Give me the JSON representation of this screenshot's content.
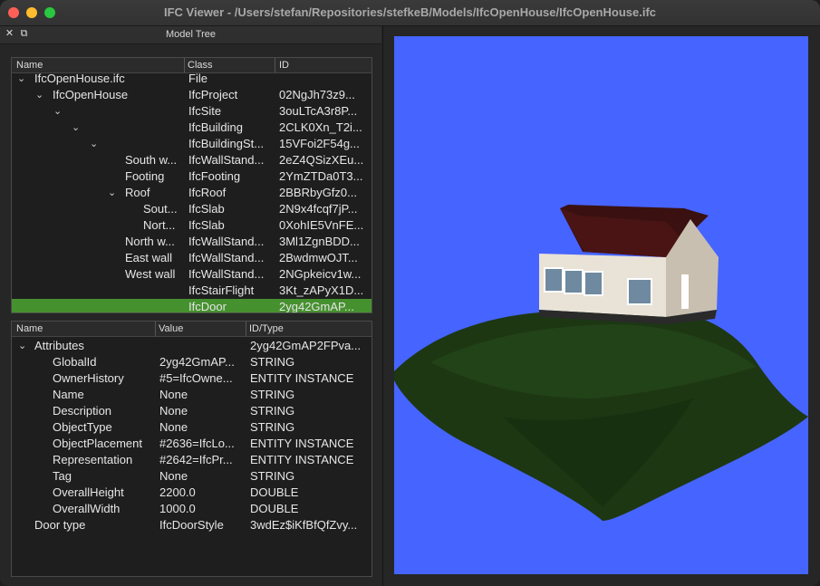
{
  "window": {
    "title": "IFC Viewer - /Users/stefan/Repositories/stefkeB/Models/IfcOpenHouse/IfcOpenHouse.ifc"
  },
  "dock": {
    "title": "Model Tree",
    "close_icon": "✕",
    "float_icon": "⧉"
  },
  "tree": {
    "columns": [
      "Name",
      "Class",
      "ID"
    ],
    "rows": [
      {
        "arrow": "⌄",
        "name": "IfcOpenHouse.ifc",
        "cls": "File",
        "id": ""
      },
      {
        "arrow": "⌄",
        "name": "IfcOpenHouse",
        "cls": "IfcProject",
        "id": "02NgJh73z9..."
      },
      {
        "arrow": "⌄",
        "name": "",
        "cls": "IfcSite",
        "id": "3ouLTcA3r8P..."
      },
      {
        "arrow": "⌄",
        "name": "",
        "cls": "IfcBuilding",
        "id": "2CLK0Xn_T2i..."
      },
      {
        "arrow": "⌄",
        "name": "",
        "cls": "IfcBuildingSt...",
        "id": "15VFoi2F54g..."
      },
      {
        "arrow": "",
        "name": "South w...",
        "cls": "IfcWallStand...",
        "id": "2eZ4QSizXEu..."
      },
      {
        "arrow": "",
        "name": "Footing",
        "cls": "IfcFooting",
        "id": "2YmZTDa0T3..."
      },
      {
        "arrow": "⌄",
        "name": "Roof",
        "cls": "IfcRoof",
        "id": "2BBRbyGfz0..."
      },
      {
        "arrow": "",
        "name": "Sout...",
        "cls": "IfcSlab",
        "id": "2N9x4fcqf7jP..."
      },
      {
        "arrow": "",
        "name": "Nort...",
        "cls": "IfcSlab",
        "id": "0XohIE5VnFE..."
      },
      {
        "arrow": "",
        "name": "North w...",
        "cls": "IfcWallStand...",
        "id": "3Ml1ZgnBDD..."
      },
      {
        "arrow": "",
        "name": "East wall",
        "cls": "IfcWallStand...",
        "id": "2BwdmwOJT..."
      },
      {
        "arrow": "",
        "name": "West wall",
        "cls": "IfcWallStand...",
        "id": "2NGpkeicv1w..."
      },
      {
        "arrow": "",
        "name": "",
        "cls": "IfcStairFlight",
        "id": "3Kt_zAPyX1D..."
      },
      {
        "arrow": "",
        "name": "",
        "cls": "IfcDoor",
        "id": "2yg42GmAP..."
      }
    ]
  },
  "props": {
    "columns": [
      "Name",
      "Value",
      "ID/Type"
    ],
    "rows": [
      {
        "arrow": "⌄",
        "name": "Attributes",
        "value": "",
        "type": "2yg42GmAP2FPva..."
      },
      {
        "arrow": "",
        "name": "GlobalId",
        "value": "2yg42GmAP...",
        "type": "STRING"
      },
      {
        "arrow": "",
        "name": "OwnerHistory",
        "value": "#5=IfcOwne...",
        "type": "ENTITY INSTANCE"
      },
      {
        "arrow": "",
        "name": "Name",
        "value": "None",
        "type": "STRING"
      },
      {
        "arrow": "",
        "name": "Description",
        "value": "None",
        "type": "STRING"
      },
      {
        "arrow": "",
        "name": "ObjectType",
        "value": "None",
        "type": "STRING"
      },
      {
        "arrow": "",
        "name": "ObjectPlacement",
        "value": "#2636=IfcLo...",
        "type": "ENTITY INSTANCE"
      },
      {
        "arrow": "",
        "name": "Representation",
        "value": "#2642=IfcPr...",
        "type": "ENTITY INSTANCE"
      },
      {
        "arrow": "",
        "name": "Tag",
        "value": "None",
        "type": "STRING"
      },
      {
        "arrow": "",
        "name": "OverallHeight",
        "value": "2200.0",
        "type": "DOUBLE"
      },
      {
        "arrow": "",
        "name": "OverallWidth",
        "value": "1000.0",
        "type": "DOUBLE"
      },
      {
        "arrow": "",
        "name": "Door type",
        "value": "IfcDoorStyle",
        "type": "3wdEz$iKfBfQfZvy..."
      }
    ]
  },
  "colors": {
    "selected_row": "#46912f",
    "viewport_bg": "#4664ff"
  }
}
